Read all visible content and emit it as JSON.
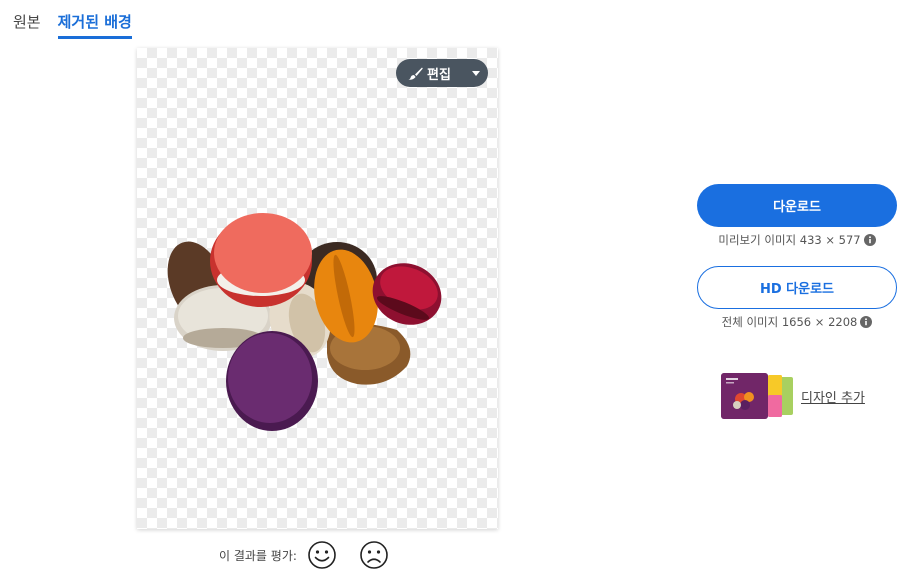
{
  "tabs": [
    {
      "label": "원본",
      "active": false
    },
    {
      "label": "제거된 배경",
      "active": true
    }
  ],
  "preview": {
    "edit_label": "편집",
    "brush_icon": "brush-icon",
    "caret_icon": "caret-down-icon"
  },
  "rating": {
    "label": "이 결과를 평가:",
    "positive_icon": "smiley-face-icon",
    "negative_icon": "sad-face-icon"
  },
  "download": {
    "label": "다운로드",
    "preview_info": "미리보기 이미지 433 × 577",
    "hd_label": "HD 다운로드",
    "full_info": "전체 이미지 1656 × 2208"
  },
  "add_design": {
    "label": "디자인 추가"
  },
  "colors": {
    "accent": "#1a6fe0",
    "edit_button_bg": "#4a5560"
  }
}
